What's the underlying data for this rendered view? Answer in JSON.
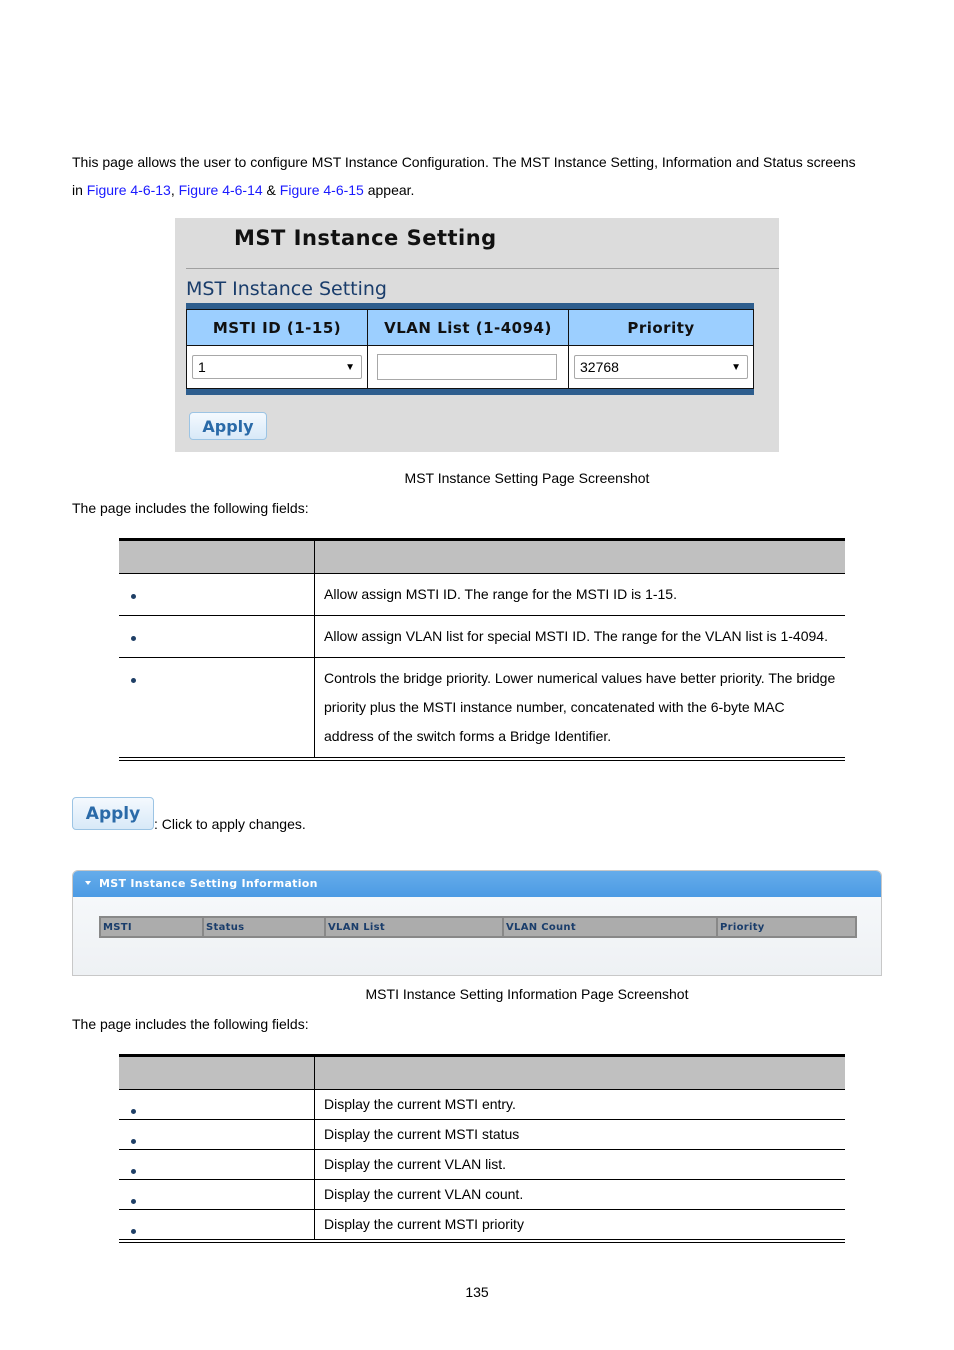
{
  "intro": {
    "line1": "This page allows the user to configure MST Instance Configuration. The MST Instance Setting, Information and Status screens",
    "line2_prefix": "in ",
    "link1": "Figure 4-6-13",
    "sep1": ", ",
    "link2": "Figure 4-6-14",
    "sep2": " & ",
    "link3": "Figure 4-6-15",
    "line2_suffix": " appear."
  },
  "setting_screenshot": {
    "page_title": "MST Instance Setting",
    "section_title": "MST Instance Setting",
    "columns": [
      "MSTI ID (1-15)",
      "VLAN List (1-4094)",
      "Priority"
    ],
    "msti_id_value": "1",
    "vlan_list_value": "",
    "priority_value": "32768",
    "apply_label": "Apply"
  },
  "caption1": "MST Instance Setting Page Screenshot",
  "fields_intro1": "The page includes the following fields:",
  "fields_table1": {
    "headers": [
      "",
      ""
    ],
    "rows": [
      {
        "object": "",
        "description": "Allow assign MSTI ID. The range for the MSTI ID is 1-15."
      },
      {
        "object": "",
        "description": "Allow assign VLAN list for special MSTI ID. The range for the VLAN list is 1-4094."
      },
      {
        "object": "",
        "description": "Controls the bridge priority. Lower numerical values have better priority. The bridge priority plus the MSTI instance number, concatenated with the 6-byte MAC address of the switch forms a Bridge Identifier."
      }
    ]
  },
  "apply_note": {
    "button_label": "Apply",
    "text": ": Click to apply changes."
  },
  "info_screenshot": {
    "panel_title": "MST Instance Setting Information",
    "columns": [
      "MSTI",
      "Status",
      "VLAN List",
      "VLAN Count",
      "Priority"
    ]
  },
  "caption2": "MSTI Instance Setting Information Page Screenshot",
  "fields_intro2": "The page includes the following fields:",
  "fields_table2": {
    "headers": [
      "",
      ""
    ],
    "rows": [
      {
        "object": "",
        "description": "Display the current MSTI entry."
      },
      {
        "object": "",
        "description": "Display the current MSTI status"
      },
      {
        "object": "",
        "description": "Display the current VLAN list."
      },
      {
        "object": "",
        "description": "Display the current VLAN count."
      },
      {
        "object": "",
        "description": "Display the current MSTI priority"
      }
    ]
  },
  "page_number": "135"
}
